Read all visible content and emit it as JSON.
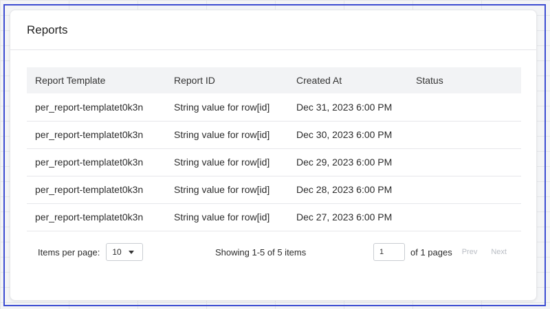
{
  "card": {
    "title": "Reports"
  },
  "table": {
    "headers": [
      "Report Template",
      "Report ID",
      "Created At",
      "Status"
    ],
    "rows": [
      {
        "template": "per_report-templatet0k3n",
        "id": "String value for row[id]",
        "created": "Dec 31, 2023 6:00 PM",
        "status": ""
      },
      {
        "template": "per_report-templatet0k3n",
        "id": "String value for row[id]",
        "created": "Dec 30, 2023 6:00 PM",
        "status": ""
      },
      {
        "template": "per_report-templatet0k3n",
        "id": "String value for row[id]",
        "created": "Dec 29, 2023 6:00 PM",
        "status": ""
      },
      {
        "template": "per_report-templatet0k3n",
        "id": "String value for row[id]",
        "created": "Dec 28, 2023 6:00 PM",
        "status": ""
      },
      {
        "template": "per_report-templatet0k3n",
        "id": "String value for row[id]",
        "created": "Dec 27, 2023 6:00 PM",
        "status": ""
      }
    ]
  },
  "pagination": {
    "items_per_page_label": "Items per page:",
    "items_per_page_value": "10",
    "showing_text": "Showing 1-5 of 5 items",
    "current_page": "1",
    "of_pages_text": "of 1 pages",
    "prev_label": "Prev",
    "next_label": "Next"
  },
  "colors": {
    "frame_border": "#3b4bd1",
    "header_bg": "#f2f3f5",
    "disabled_text": "#b8bcc3"
  },
  "icons": {
    "dropdown": "chevron-down-icon"
  }
}
